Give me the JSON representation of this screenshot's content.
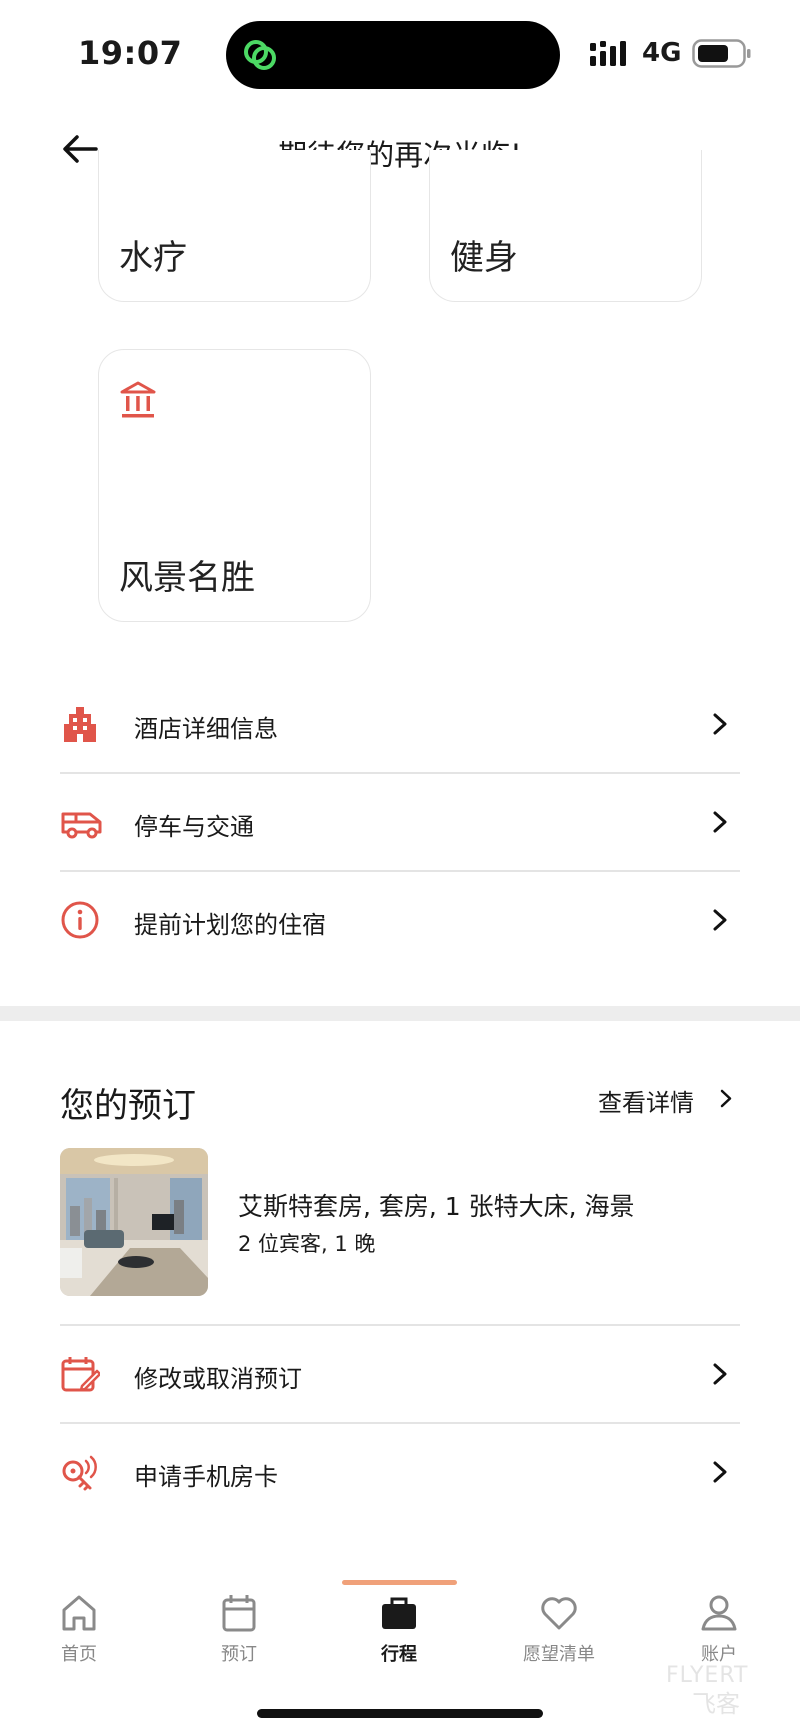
{
  "status_bar": {
    "time": "19:07",
    "network": "4G"
  },
  "header": {
    "title": "期待您的再次光临!"
  },
  "amenity_cards": [
    {
      "label": "水疗"
    },
    {
      "label": "健身"
    },
    {
      "label": "风景名胜",
      "icon": "landmark-icon"
    }
  ],
  "info_rows": [
    {
      "label": "酒店详细信息",
      "icon": "building-icon"
    },
    {
      "label": "停车与交通",
      "icon": "van-icon"
    },
    {
      "label": "提前计划您的住宿",
      "icon": "info-icon"
    }
  ],
  "booking": {
    "title": "您的预订",
    "view_details": "查看详情",
    "room_name": "艾斯特套房, 套房, 1 张特大床, 海景",
    "guests": "2 位宾客, 1 晚",
    "actions": [
      {
        "label": "修改或取消预订",
        "icon": "calendar-edit-icon"
      },
      {
        "label": "申请手机房卡",
        "icon": "mobile-key-icon"
      }
    ]
  },
  "tabs": [
    {
      "label": "首页",
      "icon": "home-icon",
      "active": false
    },
    {
      "label": "预订",
      "icon": "calendar-icon",
      "active": false
    },
    {
      "label": "行程",
      "icon": "briefcase-icon",
      "active": true
    },
    {
      "label": "愿望清单",
      "icon": "heart-icon",
      "active": false
    },
    {
      "label": "账户",
      "icon": "account-icon",
      "active": false
    }
  ],
  "watermark": {
    "text_latin": "FLYERT",
    "text_cn": "飞客"
  },
  "colors": {
    "accent": "#e0554a",
    "tab_indicator": "#f0a17a",
    "divider": "#e4e4e4"
  }
}
